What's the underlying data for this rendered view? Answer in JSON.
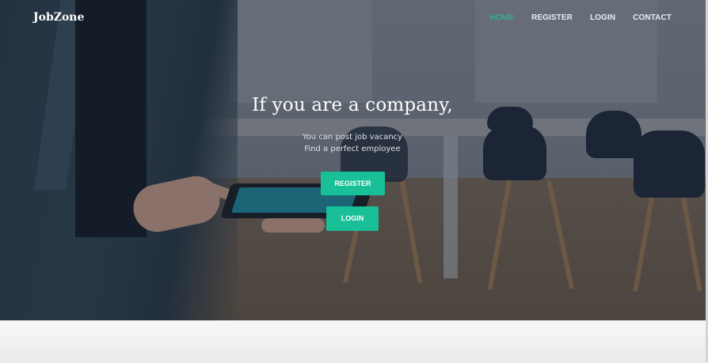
{
  "brand": {
    "name": "JobZone"
  },
  "nav": {
    "items": [
      {
        "label": "HOME",
        "active": true
      },
      {
        "label": "REGISTER",
        "active": false
      },
      {
        "label": "LOGIN",
        "active": false
      },
      {
        "label": "CONTACT",
        "active": false
      }
    ]
  },
  "hero": {
    "title": "If you are a company,",
    "subtitle_line1": "You can post job vacancy",
    "subtitle_line2": "Find a perfect employee",
    "register_button": "REGISTER",
    "login_button": "LOGIN"
  },
  "colors": {
    "accent": "#19bf97",
    "nav_active": "#1fc8a0",
    "text_light": "#ffffff"
  }
}
